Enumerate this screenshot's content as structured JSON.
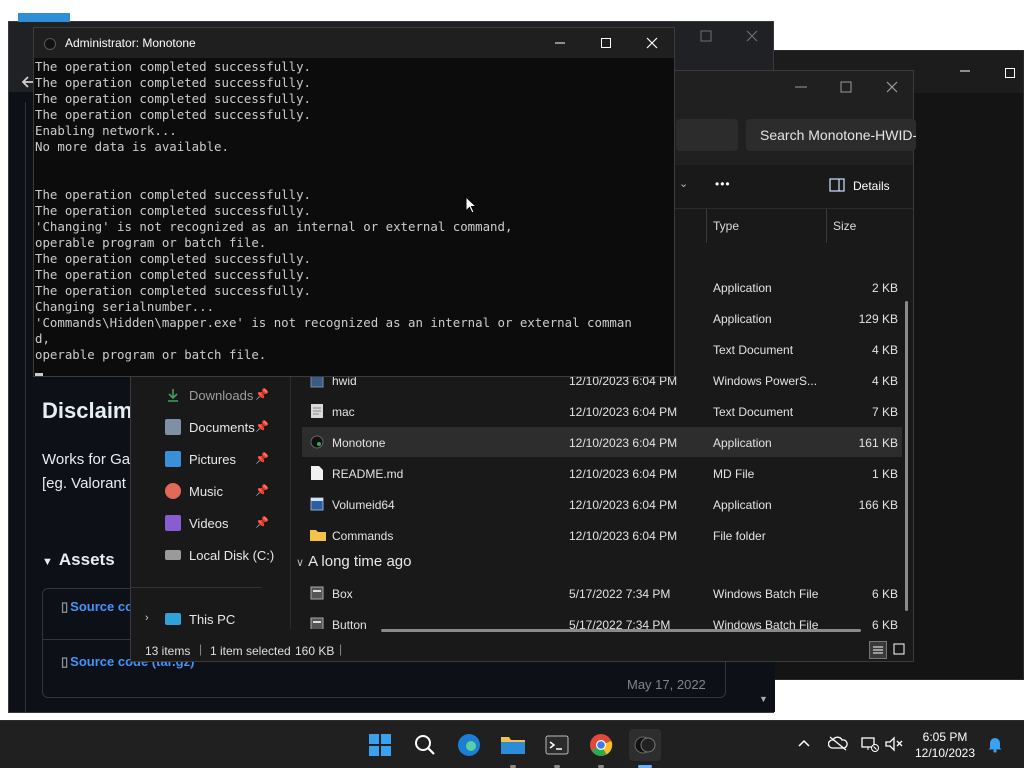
{
  "terminal": {
    "title": "Administrator: Monotone",
    "output": "The operation completed successfully.\nThe operation completed successfully.\nThe operation completed successfully.\nThe operation completed successfully.\nEnabling network...\nNo more data is available.\n\n\nThe operation completed successfully.\nThe operation completed successfully.\n'Changing' is not recognized as an internal or external command,\noperable program or batch file.\nThe operation completed successfully.\nThe operation completed successfully.\nThe operation completed successfully.\nChanging serialnumber...\n'Commands\\Hidden\\mapper.exe' is not recognized as an internal or external comman\nd,\noperable program or batch file."
  },
  "explorer": {
    "search_placeholder": "Search Monotone-HWID-",
    "details_label": "Details",
    "more_label": "•••",
    "columns": {
      "type": "Type",
      "size": "Size"
    },
    "nav": [
      {
        "label": "Downloads",
        "icon": "downloads-icon",
        "color": "#3fa35a"
      },
      {
        "label": "Documents",
        "icon": "documents-icon",
        "color": "#7f8fa6"
      },
      {
        "label": "Pictures",
        "icon": "pictures-icon",
        "color": "#3b8fd9"
      },
      {
        "label": "Music",
        "icon": "music-icon",
        "color": "#e2685a"
      },
      {
        "label": "Videos",
        "icon": "videos-icon",
        "color": "#8a5cd1"
      },
      {
        "label": "Local Disk (C:)",
        "icon": "disk-icon",
        "color": "#9a9a9a"
      },
      {
        "label": "This PC",
        "icon": "pc-icon",
        "color": "#2fa3d8"
      }
    ],
    "partial_rows": [
      {
        "type": "Application",
        "size": "2 KB"
      },
      {
        "type": "Application",
        "size": "129 KB"
      },
      {
        "type": "Text Document",
        "size": "4 KB"
      }
    ],
    "rows": [
      {
        "name": "hwid",
        "date": "12/10/2023 6:04 PM",
        "type": "Windows PowerS...",
        "size": "4 KB"
      },
      {
        "name": "mac",
        "date": "12/10/2023 6:04 PM",
        "type": "Text Document",
        "size": "7 KB"
      },
      {
        "name": "Monotone",
        "date": "12/10/2023 6:04 PM",
        "type": "Application",
        "size": "161 KB"
      },
      {
        "name": "README.md",
        "date": "12/10/2023 6:04 PM",
        "type": "MD File",
        "size": "1 KB"
      },
      {
        "name": "Volumeid64",
        "date": "12/10/2023 6:04 PM",
        "type": "Application",
        "size": "166 KB"
      },
      {
        "name": "Commands",
        "date": "12/10/2023 6:04 PM",
        "type": "File folder",
        "size": ""
      }
    ],
    "group_label": "A long time ago",
    "old_rows": [
      {
        "name": "Box",
        "date": "5/17/2022 7:34 PM",
        "type": "Windows Batch File",
        "size": "6 KB"
      },
      {
        "name": "Button",
        "date": "5/17/2022 7:34 PM",
        "type": "Windows Batch File",
        "size": "6 KB"
      }
    ],
    "status": {
      "items": "13 items",
      "selected": "1 item selected",
      "size": "160 KB"
    }
  },
  "browser": {
    "disclaimer_heading": "Disclaim",
    "works_text_1": "Works for Ga",
    "works_text_2": "[eg. Valorant",
    "assets_label": "Assets",
    "source_1": "Source co",
    "source_2": "Source code (tar.gz)",
    "release_date": "May 17, 2022"
  },
  "taskbar": {
    "time": "6:05 PM",
    "date": "12/10/2023"
  }
}
